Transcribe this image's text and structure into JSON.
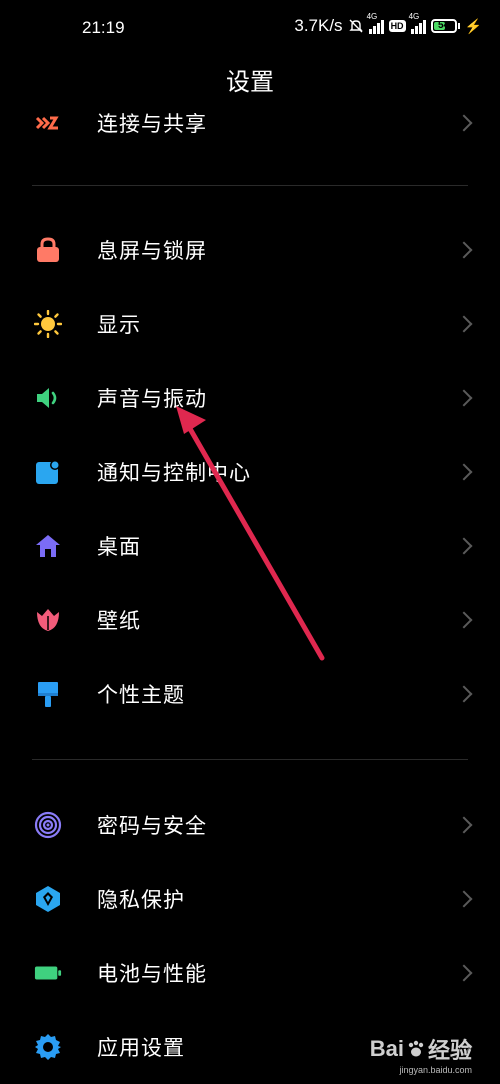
{
  "status_bar": {
    "time": "21:19",
    "net_speed": "3.7K/s",
    "signal1_tag": "4G",
    "hd_badge": "HD",
    "signal2_tag": "4G",
    "battery_level": "54",
    "battery_fill_fraction": 0.54
  },
  "header": {
    "title": "设置"
  },
  "settings": [
    {
      "label": "连接与共享",
      "icon": "share-icon",
      "color": "#ff6b4a"
    },
    {
      "label": "息屏与锁屏",
      "icon": "lock-icon",
      "color": "#ff7a66"
    },
    {
      "label": "显示",
      "icon": "sun-icon",
      "color": "#ffc83d"
    },
    {
      "label": "声音与振动",
      "icon": "speaker-icon",
      "color": "#3fd17f"
    },
    {
      "label": "通知与控制中心",
      "icon": "notification-icon",
      "color": "#2aa6f0"
    },
    {
      "label": "桌面",
      "icon": "home-icon",
      "color": "#7b6cf6"
    },
    {
      "label": "壁纸",
      "icon": "tulip-icon",
      "color": "#f25c7a"
    },
    {
      "label": "个性主题",
      "icon": "brush-icon",
      "color": "#2a9df4"
    },
    {
      "label": "密码与安全",
      "icon": "fingerprint-icon",
      "color": "#8a7cf8"
    },
    {
      "label": "隐私保护",
      "icon": "privacy-icon",
      "color": "#2aa6f0"
    },
    {
      "label": "电池与性能",
      "icon": "battery-icon",
      "color": "#3fd17f"
    },
    {
      "label": "应用设置",
      "icon": "gear-icon",
      "color": "#2a9df4"
    }
  ],
  "annotation": {
    "arrow_color": "#e0284f"
  },
  "watermark": {
    "brand": "Bai",
    "brand2": "经验",
    "url": "jingyan.baidu.com"
  }
}
